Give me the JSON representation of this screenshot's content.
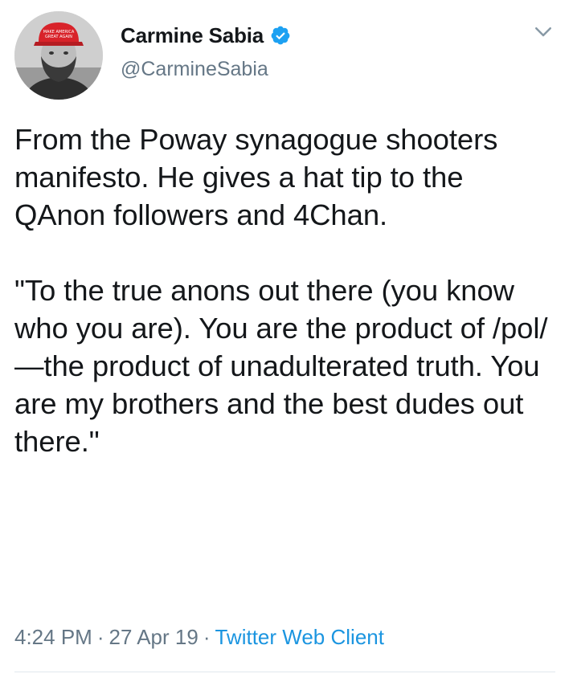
{
  "author": {
    "display_name": "Carmine Sabia",
    "handle": "@CarmineSabia",
    "verified": true,
    "avatar_hat_text": "MAKE AMERICA GREAT AGAIN"
  },
  "tweet": {
    "paragraphs": [
      "From the Poway synagogue shooters manifesto. He gives a hat tip to the QAnon followers and 4Chan.",
      "\"To the true anons out there (you know who you are). You are the product of /pol/—the product of unadulterated truth. You are my brothers and the best dudes out there.\""
    ]
  },
  "meta": {
    "time": "4:24 PM",
    "separator": "·",
    "date": "27 Apr 19",
    "source": "Twitter Web Client"
  },
  "icons": {
    "verified": "verified-badge-icon",
    "menu": "chevron-down-icon"
  },
  "colors": {
    "text": "#14171a",
    "secondary": "#657786",
    "accent": "#1b95e0",
    "verified": "#1da1f2",
    "divider": "#e1e8ed"
  }
}
